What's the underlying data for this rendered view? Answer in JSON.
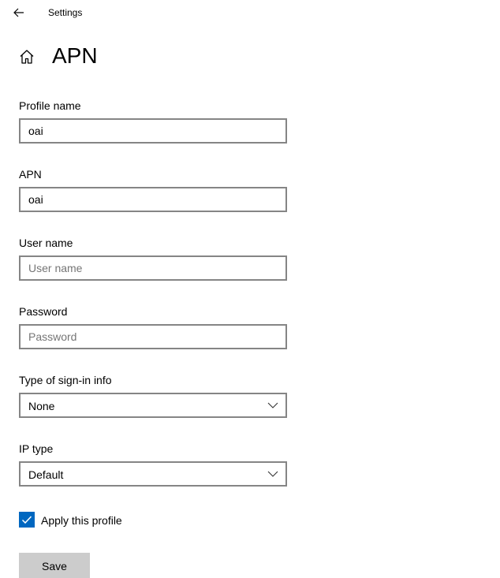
{
  "window": {
    "app_title": "Settings"
  },
  "header": {
    "title": "APN"
  },
  "form": {
    "profile_name": {
      "label": "Profile name",
      "value": "oai",
      "placeholder": ""
    },
    "apn": {
      "label": "APN",
      "value": "oai",
      "placeholder": ""
    },
    "user_name": {
      "label": "User name",
      "value": "",
      "placeholder": "User name"
    },
    "password": {
      "label": "Password",
      "value": "",
      "placeholder": "Password"
    },
    "sign_in_type": {
      "label": "Type of sign-in info",
      "selected": "None"
    },
    "ip_type": {
      "label": "IP type",
      "selected": "Default"
    },
    "apply_profile": {
      "label": "Apply this profile",
      "checked": true
    },
    "save_label": "Save"
  },
  "icons": {
    "back": "back-arrow-icon",
    "home": "home-icon",
    "dropdown": "chevron-down-icon",
    "check": "checkmark-icon"
  },
  "colors": {
    "accent": "#0067c0",
    "input_border": "#858585",
    "button_bg": "#cccccc",
    "placeholder": "#757575"
  }
}
